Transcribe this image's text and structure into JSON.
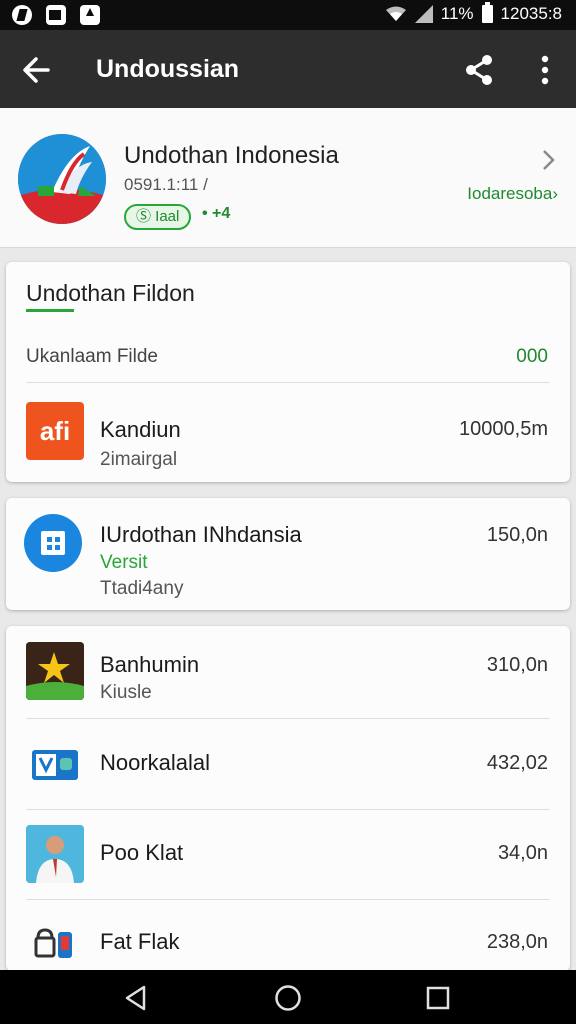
{
  "status_bar": {
    "battery": "11%",
    "time": "12035:8"
  },
  "app_bar": {
    "title": "Undoussian"
  },
  "hero": {
    "name": "Undothan Indonesia",
    "meta": "0591.1:11 /",
    "badge": "Ⓢ Iaal",
    "rating": "• +4",
    "link": "Iodaresoba›"
  },
  "card1": {
    "heading": "Undothan Fildon",
    "subheading": "Ukanlaam Filde",
    "subheading_value": "000",
    "item": {
      "title": "Kandiun",
      "subtitle": "2imairgal",
      "value": "10000,5m",
      "icon_text": "afi"
    }
  },
  "card2": {
    "title": "IUrdothan INhdansia",
    "version": "Versit",
    "subtitle": "Ttadi4any",
    "value": "150,0n"
  },
  "card3": {
    "items": [
      {
        "title": "Banhumin",
        "subtitle": "Kiusle",
        "value": "310,0n"
      },
      {
        "title": "Noorkalalal",
        "subtitle": "",
        "value": "432,02"
      },
      {
        "title": "Poo Klat",
        "subtitle": "",
        "value": "34,0n"
      },
      {
        "title": "Fat Flak",
        "subtitle": "",
        "value": "238,0n"
      }
    ]
  },
  "colors": {
    "app_bar": "#2d2d2d",
    "accent_green": "#27a63a",
    "status_bar": "#0d0d0d"
  }
}
